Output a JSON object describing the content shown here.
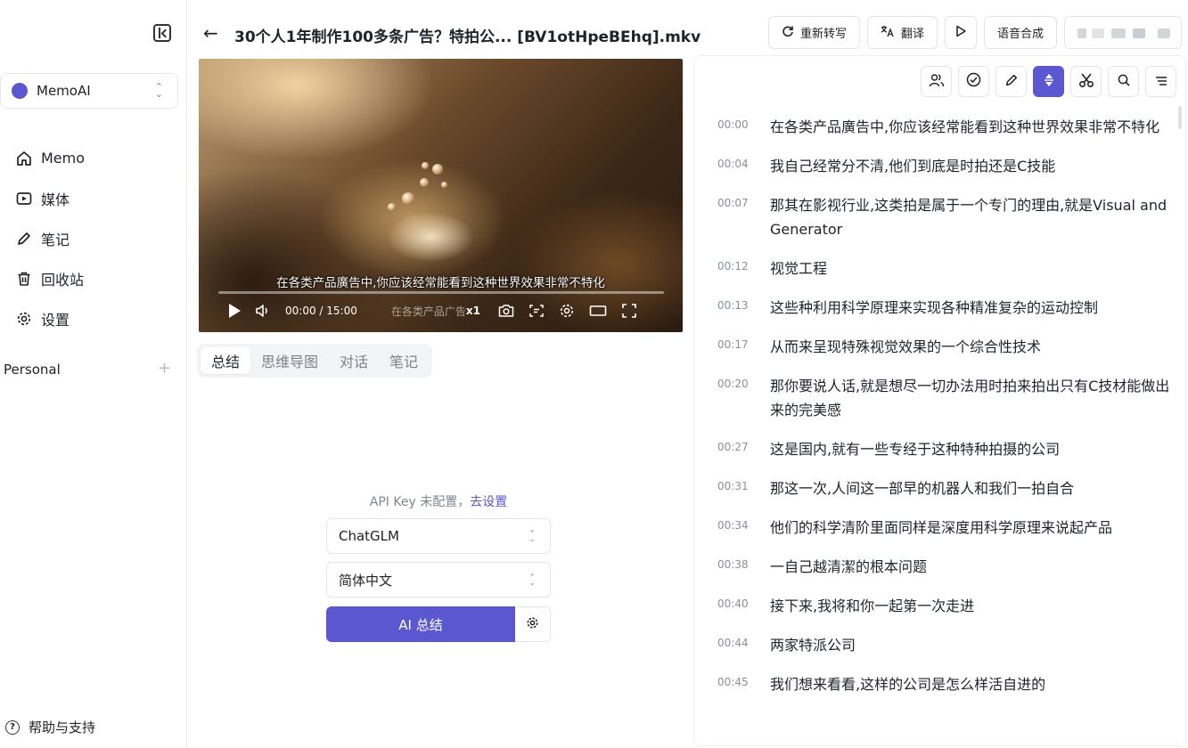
{
  "sidebar": {
    "workspace": "MemoAI",
    "nav": [
      {
        "label": "Memo",
        "icon": "home-icon"
      },
      {
        "label": "媒体",
        "icon": "media-icon"
      },
      {
        "label": "笔记",
        "icon": "pencil-icon"
      },
      {
        "label": "回收站",
        "icon": "trash-icon"
      },
      {
        "label": "设置",
        "icon": "gear-icon"
      }
    ],
    "section_label": "Personal",
    "help_label": "帮助与支持"
  },
  "header": {
    "title": "30个人1年制作100多条广告？特拍公... [BV1otHpeBEhq].mkv",
    "actions": [
      "重新转写",
      "翻译",
      "语音合成"
    ]
  },
  "video": {
    "subtitle": "在各类产品廣告中,你应该经常能看到这种世界效果非常不特化",
    "time": "00:00 / 15:00",
    "ghost_text": "在各类产品广告",
    "speed": "x1",
    "progress": 0.0
  },
  "tabs": [
    "总结",
    "思维导图",
    "对话",
    "笔记"
  ],
  "summary": {
    "api_hint_prefix": "API Key 未配置，",
    "api_hint_link": "去设置",
    "model": "ChatGLM",
    "language": "简体中文",
    "button": "AI 总结"
  },
  "transcript": {
    "tools": [
      "speakers-icon",
      "check-circle-icon",
      "pencil-icon",
      "follow-icon",
      "scissors-icon",
      "search-icon",
      "menu-icon"
    ],
    "segments": [
      {
        "time": "00:00",
        "text": "在各类产品廣告中,你应该经常能看到这种世界效果非常不特化"
      },
      {
        "time": "00:04",
        "text": "我自己经常分不清,他们到底是时拍还是C技能"
      },
      {
        "time": "00:07",
        "text": "那其在影视行业,这类拍是属于一个专门的理由,就是Visual and Generator"
      },
      {
        "time": "00:12",
        "text": "视觉工程"
      },
      {
        "time": "00:13",
        "text": "这些种利用科学原理来实现各种精准复杂的运动控制"
      },
      {
        "time": "00:17",
        "text": "从而来呈现特殊视觉效果的一个综合性技术"
      },
      {
        "time": "00:20",
        "text": "那你要说人话,就是想尽一切办法用时拍来拍出只有C技材能做出来的完美感"
      },
      {
        "time": "00:27",
        "text": "这是国内,就有一些专经于这种特种拍摄的公司"
      },
      {
        "time": "00:31",
        "text": "那这一次,人间这一部早的机器人和我们一拍自合"
      },
      {
        "time": "00:34",
        "text": "他们的科学清阶里面同样是深度用科学原理来说起产品"
      },
      {
        "time": "00:38",
        "text": "一自己越清潔的根本问题"
      },
      {
        "time": "00:40",
        "text": "接下来,我将和你一起第一次走进"
      },
      {
        "time": "00:44",
        "text": "两家特派公司"
      },
      {
        "time": "00:45",
        "text": "我们想来看看,这样的公司是怎么样活自进的"
      }
    ]
  },
  "colors": {
    "accent": "#5b57d1",
    "muted": "#8a8f99"
  }
}
